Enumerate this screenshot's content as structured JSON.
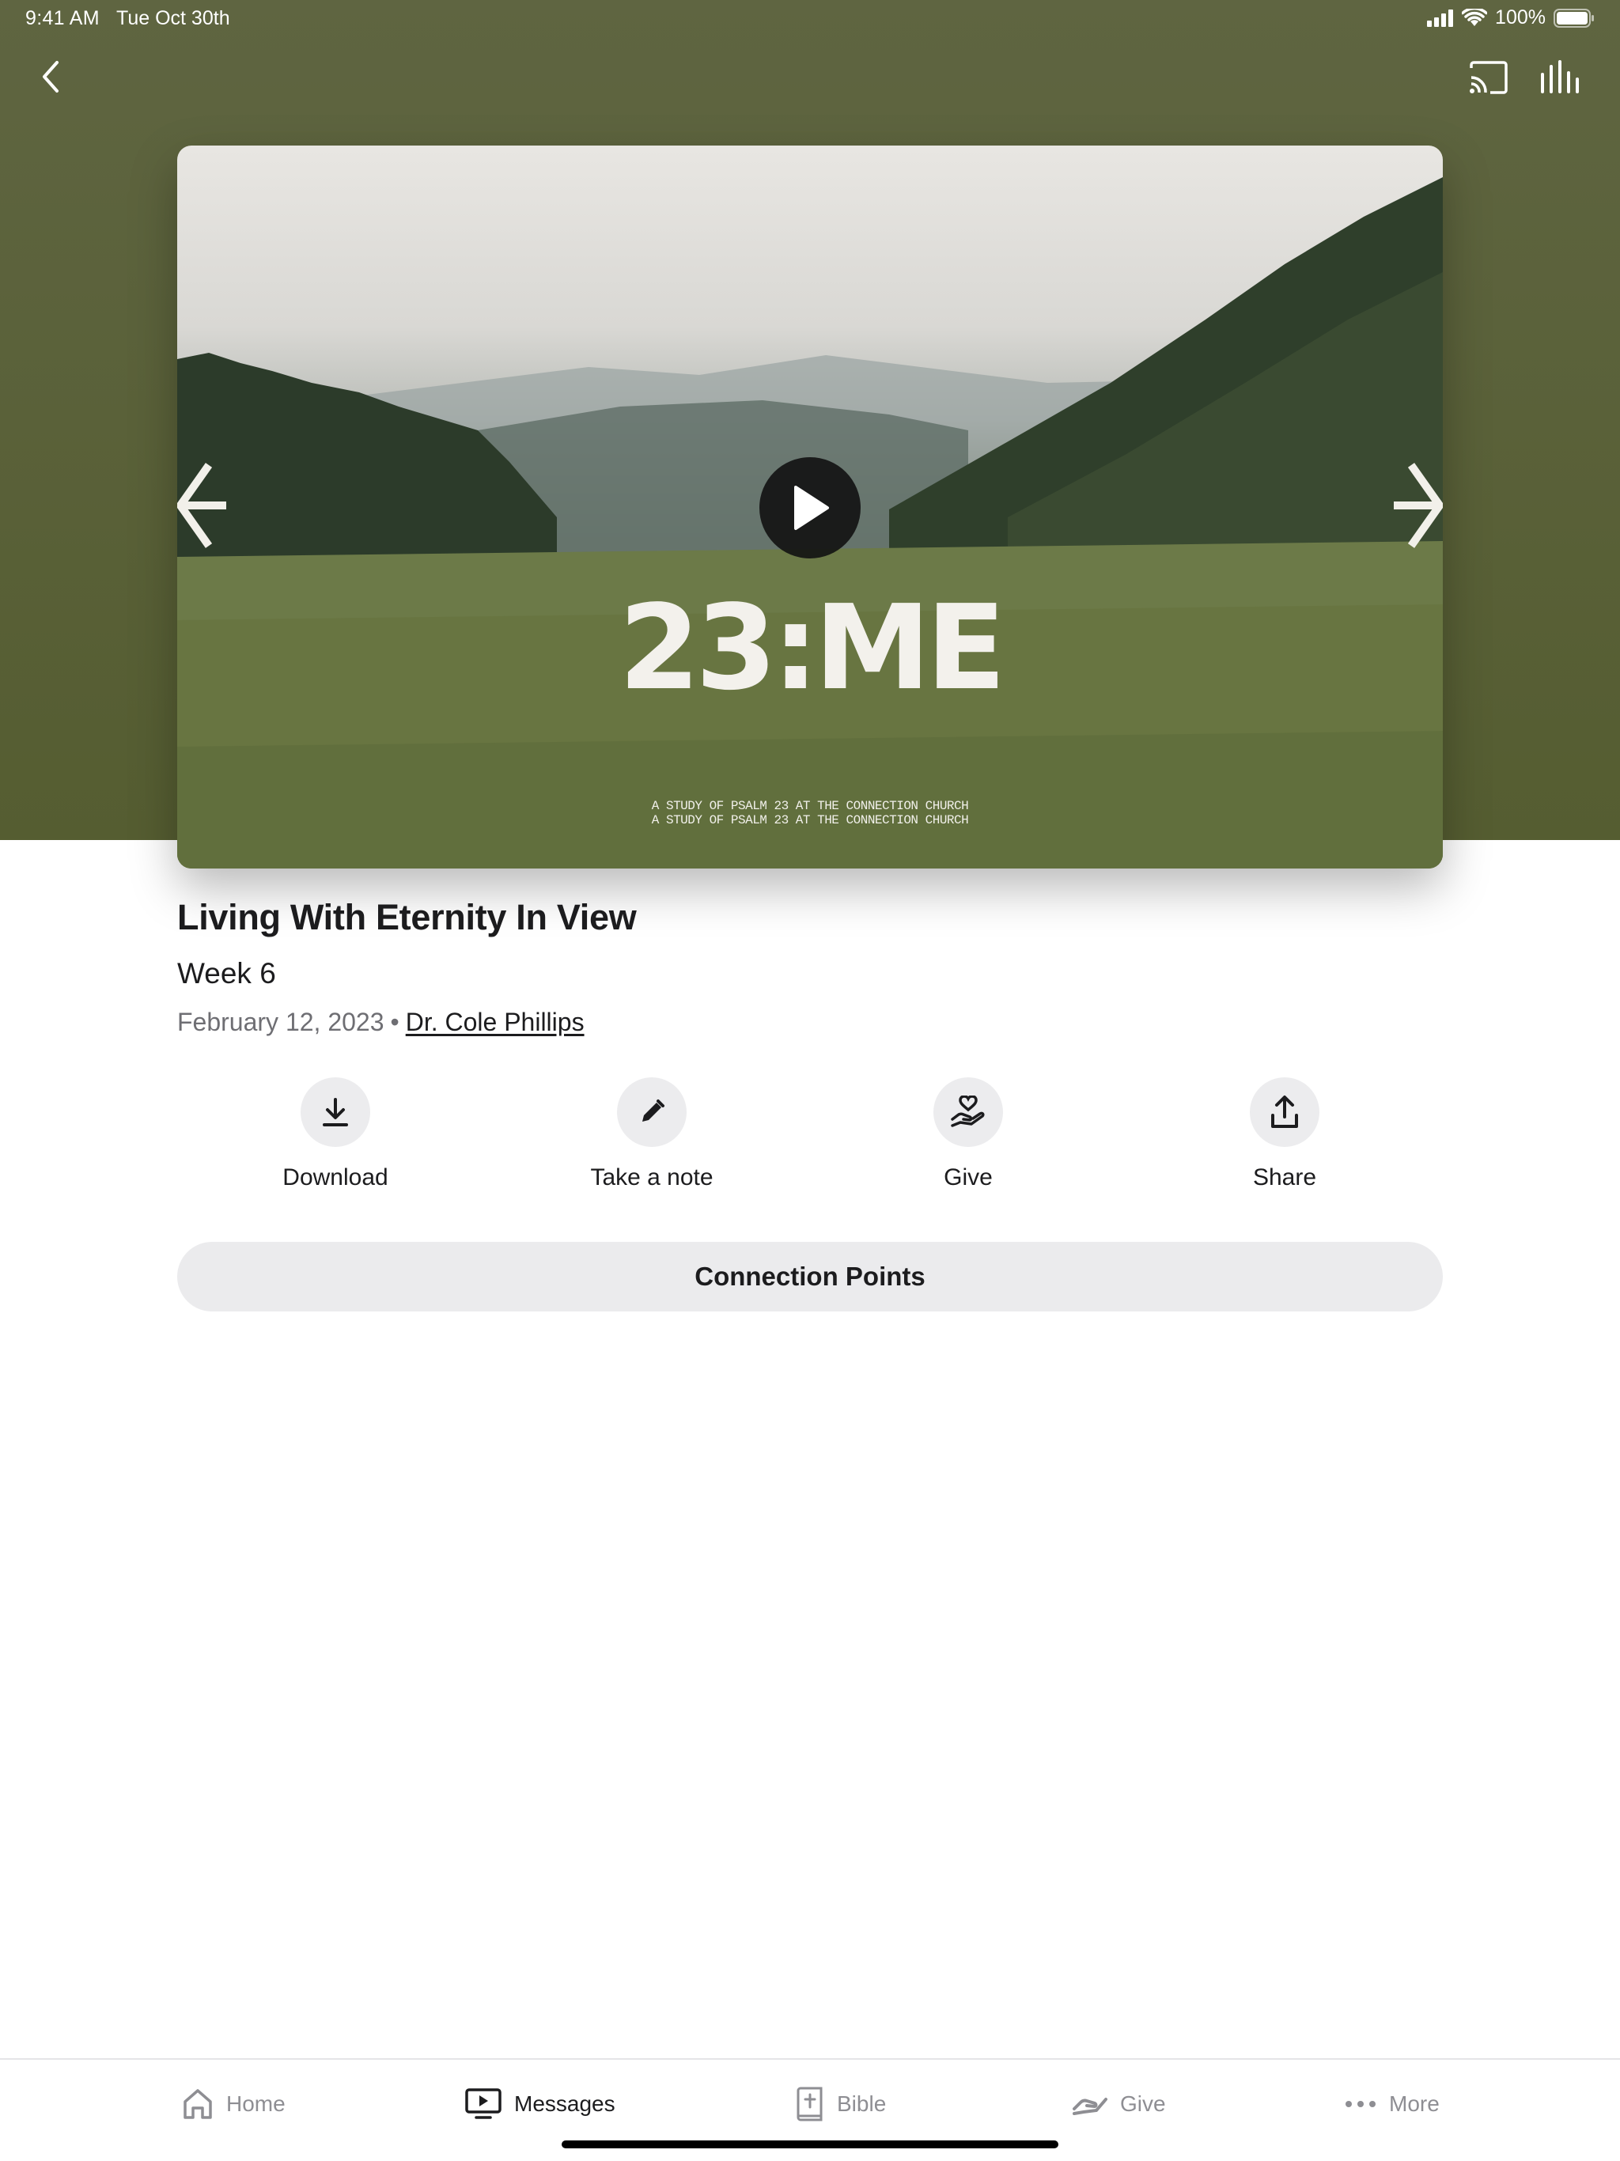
{
  "status_bar": {
    "time": "9:41 AM",
    "date": "Tue Oct 30th",
    "battery": "100%"
  },
  "header": {
    "back_icon": "chevron-left-icon",
    "cast_icon": "cast-icon",
    "stats_icon": "equalizer-icon"
  },
  "video": {
    "title_art": "23:ME",
    "subtitle_line1": "A STUDY OF PSALM 23 AT THE CONNECTION CHURCH",
    "subtitle_line2": "A STUDY OF PSALM 23 AT THE CONNECTION CHURCH",
    "play_icon": "play-icon"
  },
  "message": {
    "title": "Living With Eternity In View",
    "week": "Week 6",
    "date": "February 12, 2023",
    "separator": "•",
    "speaker": "Dr. Cole Phillips"
  },
  "actions": [
    {
      "label": "Download",
      "icon": "download-icon"
    },
    {
      "label": "Take a note",
      "icon": "pencil-icon"
    },
    {
      "label": "Give",
      "icon": "hand-heart-icon"
    },
    {
      "label": "Share",
      "icon": "share-icon"
    }
  ],
  "connection_points": {
    "label": "Connection Points"
  },
  "tabbar": {
    "items": [
      {
        "label": "Home",
        "icon": "home-icon",
        "active": false
      },
      {
        "label": "Messages",
        "icon": "tv-play-icon",
        "active": true
      },
      {
        "label": "Bible",
        "icon": "bible-icon",
        "active": false
      },
      {
        "label": "Give",
        "icon": "give-icon",
        "active": false
      },
      {
        "label": "More",
        "icon": "more-dots-icon",
        "active": false
      }
    ]
  },
  "colors": {
    "header_bg": "#5a6139",
    "text_primary": "#1c1c1e",
    "text_secondary": "#6e6e73",
    "tab_inactive": "#8e8e93",
    "button_bg": "#ebebed"
  }
}
